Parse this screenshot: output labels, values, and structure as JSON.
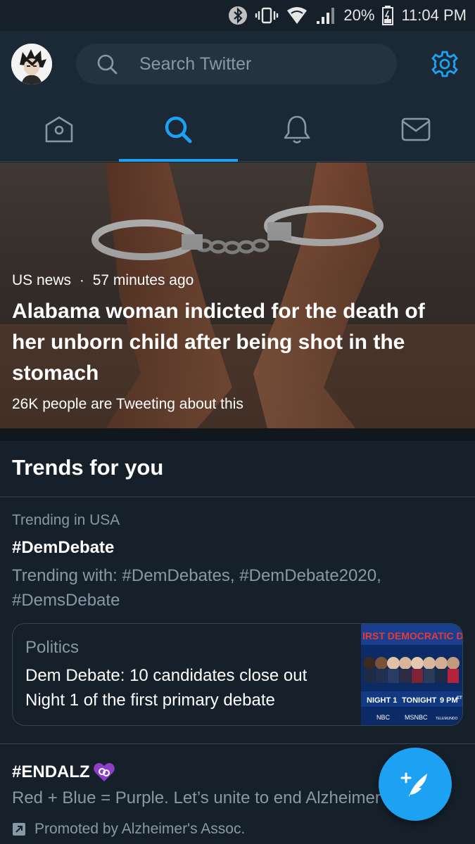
{
  "status_bar": {
    "battery": "20%",
    "time": "11:04 PM",
    "icons": [
      "bluetooth-icon",
      "vibrate-icon",
      "wifi-icon",
      "signal-icon",
      "battery-icon"
    ]
  },
  "header": {
    "search_placeholder": "Search Twitter",
    "avatar_icon": "avatar",
    "settings_icon": "gear-icon"
  },
  "tabs": [
    {
      "name": "home",
      "icon": "home-icon",
      "active": false
    },
    {
      "name": "search",
      "icon": "search-icon",
      "active": true
    },
    {
      "name": "notifications",
      "icon": "bell-icon",
      "active": false
    },
    {
      "name": "messages",
      "icon": "mail-icon",
      "active": false
    }
  ],
  "hero": {
    "category": "US news",
    "separator": "·",
    "time": "57 minutes ago",
    "title": "Alabama woman indicted for the death of her unborn child after being shot in the stomach",
    "count": "26K people are Tweeting about this"
  },
  "trends": {
    "title": "Trends for you",
    "items": [
      {
        "context": "Trending in USA",
        "name": "#DemDebate",
        "with": "Trending with: #DemDebates, #DemDebate2020, #DemsDebate",
        "card": {
          "category": "Politics",
          "title": "Dem Debate: 10 candidates close out Night 1 of the first primary debate",
          "thumb_banner": "IRST DEMOCRATIC DI",
          "thumb_night": "NIGHT 1",
          "thumb_tonight": "TONIGHT",
          "thumb_time": "9 PM",
          "thumb_time_zone": "ET",
          "thumb_networks": [
            "NBC",
            "MSNBC",
            "TELEMUNDO"
          ]
        }
      },
      {
        "name": "#ENDALZ",
        "emoji": "purple-heart-icon",
        "description": "Red + Blue = Purple. Let’s unite to end Alzheimer’s",
        "promoted": "Promoted by Alzheimer's Assoc."
      }
    ]
  },
  "fab": {
    "icon": "compose-tweet-icon"
  },
  "colors": {
    "background": "#15202b",
    "header": "#1b2836",
    "accent": "#1da1f2",
    "muted_text": "#8899a6",
    "divider": "#38444d"
  }
}
